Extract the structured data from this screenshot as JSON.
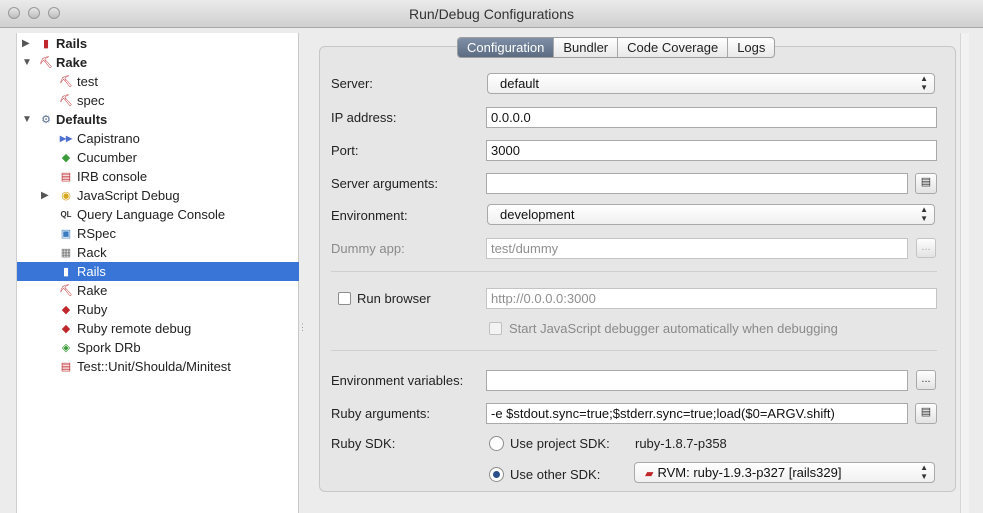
{
  "window": {
    "title": "Run/Debug Configurations"
  },
  "tree": [
    {
      "label": "Rails",
      "bold": true,
      "indent": 0,
      "arrow": "▶",
      "icon": "rails-icon",
      "glyph": "▮",
      "color": "#c0272d"
    },
    {
      "label": "Rake",
      "bold": true,
      "indent": 0,
      "arrow": "▼",
      "icon": "rake-icon",
      "glyph": "⛏",
      "color": "#c0272d"
    },
    {
      "label": "test",
      "bold": false,
      "indent": 1,
      "arrow": "",
      "icon": "rake-icon",
      "glyph": "⛏",
      "color": "#c0272d"
    },
    {
      "label": "spec",
      "bold": false,
      "indent": 1,
      "arrow": "",
      "icon": "rake-icon",
      "glyph": "⛏",
      "color": "#c0272d"
    },
    {
      "label": "Defaults",
      "bold": true,
      "indent": 0,
      "arrow": "▼",
      "icon": "defaults-wrench-icon",
      "glyph": "⚙",
      "color": "#5a6f95"
    },
    {
      "label": "Capistrano",
      "bold": false,
      "indent": 1,
      "arrow": "",
      "icon": "capistrano-icon",
      "glyph": "▶▶",
      "color": "#4d6fd0"
    },
    {
      "label": "Cucumber",
      "bold": false,
      "indent": 1,
      "arrow": "",
      "icon": "cucumber-icon",
      "glyph": "◆",
      "color": "#3b9b3b"
    },
    {
      "label": "IRB console",
      "bold": false,
      "indent": 1,
      "arrow": "",
      "icon": "irb-console-icon",
      "glyph": "▤",
      "color": "#c0272d"
    },
    {
      "label": "JavaScript Debug",
      "bold": false,
      "indent": 1,
      "arrow": "▶",
      "icon": "javascript-debug-icon",
      "glyph": "◉",
      "color": "#d8a520"
    },
    {
      "label": "Query Language Console",
      "bold": false,
      "indent": 1,
      "arrow": "",
      "icon": "query-console-icon",
      "glyph": "QL",
      "color": "#333333"
    },
    {
      "label": "RSpec",
      "bold": false,
      "indent": 1,
      "arrow": "",
      "icon": "rspec-icon",
      "glyph": "▣",
      "color": "#3b7bbf"
    },
    {
      "label": "Rack",
      "bold": false,
      "indent": 1,
      "arrow": "",
      "icon": "rack-icon",
      "glyph": "▦",
      "color": "#777777"
    },
    {
      "label": "Rails",
      "bold": false,
      "indent": 1,
      "arrow": "",
      "icon": "rails-icon",
      "glyph": "▮",
      "color": "#c0272d",
      "selected": true
    },
    {
      "label": "Rake",
      "bold": false,
      "indent": 1,
      "arrow": "",
      "icon": "rake-icon",
      "glyph": "⛏",
      "color": "#c0272d"
    },
    {
      "label": "Ruby",
      "bold": false,
      "indent": 1,
      "arrow": "",
      "icon": "ruby-icon",
      "glyph": "◆",
      "color": "#c0272d"
    },
    {
      "label": "Ruby remote debug",
      "bold": false,
      "indent": 1,
      "arrow": "",
      "icon": "ruby-remote-debug-icon",
      "glyph": "◆",
      "color": "#c0272d"
    },
    {
      "label": "Spork DRb",
      "bold": false,
      "indent": 1,
      "arrow": "",
      "icon": "spork-drb-icon",
      "glyph": "◈",
      "color": "#3b9b3b"
    },
    {
      "label": "Test::Unit/Shoulda/Minitest",
      "bold": false,
      "indent": 1,
      "arrow": "",
      "icon": "test-unit-icon",
      "glyph": "▤",
      "color": "#c0272d"
    }
  ],
  "tabs": [
    {
      "label": "Configuration",
      "active": true
    },
    {
      "label": "Bundler",
      "active": false
    },
    {
      "label": "Code Coverage",
      "active": false
    },
    {
      "label": "Logs",
      "active": false
    }
  ],
  "form": {
    "server_label": "Server:",
    "server_value": "default",
    "ip_label": "IP address:",
    "ip_value": "0.0.0.0",
    "port_label": "Port:",
    "port_value": "3000",
    "server_args_label": "Server arguments:",
    "server_args_value": "",
    "environment_label": "Environment:",
    "environment_value": "development",
    "dummy_app_label": "Dummy app:",
    "dummy_app_value": "test/dummy",
    "browse_label": "...",
    "run_browser_label": "Run browser",
    "run_browser_checked": false,
    "run_browser_url": "http://0.0.0.0:3000",
    "js_debugger_label": "Start JavaScript debugger automatically when debugging",
    "env_vars_label": "Environment variables:",
    "env_vars_value": "",
    "ruby_args_label": "Ruby arguments:",
    "ruby_args_value": "-e $stdout.sync=true;$stderr.sync=true;load($0=ARGV.shift)",
    "ruby_sdk_label": "Ruby SDK:",
    "use_project_sdk_label": "Use project SDK:",
    "project_sdk_value": "ruby-1.8.7-p358",
    "use_other_sdk_label": "Use other SDK:",
    "other_sdk_value": "RVM: ruby-1.9.3-p327 [rails329]",
    "selected_sdk": "other"
  },
  "colors": {
    "selection": "#3875d7",
    "active_tab": "#6b7b93",
    "ruby_red": "#c0272d"
  }
}
